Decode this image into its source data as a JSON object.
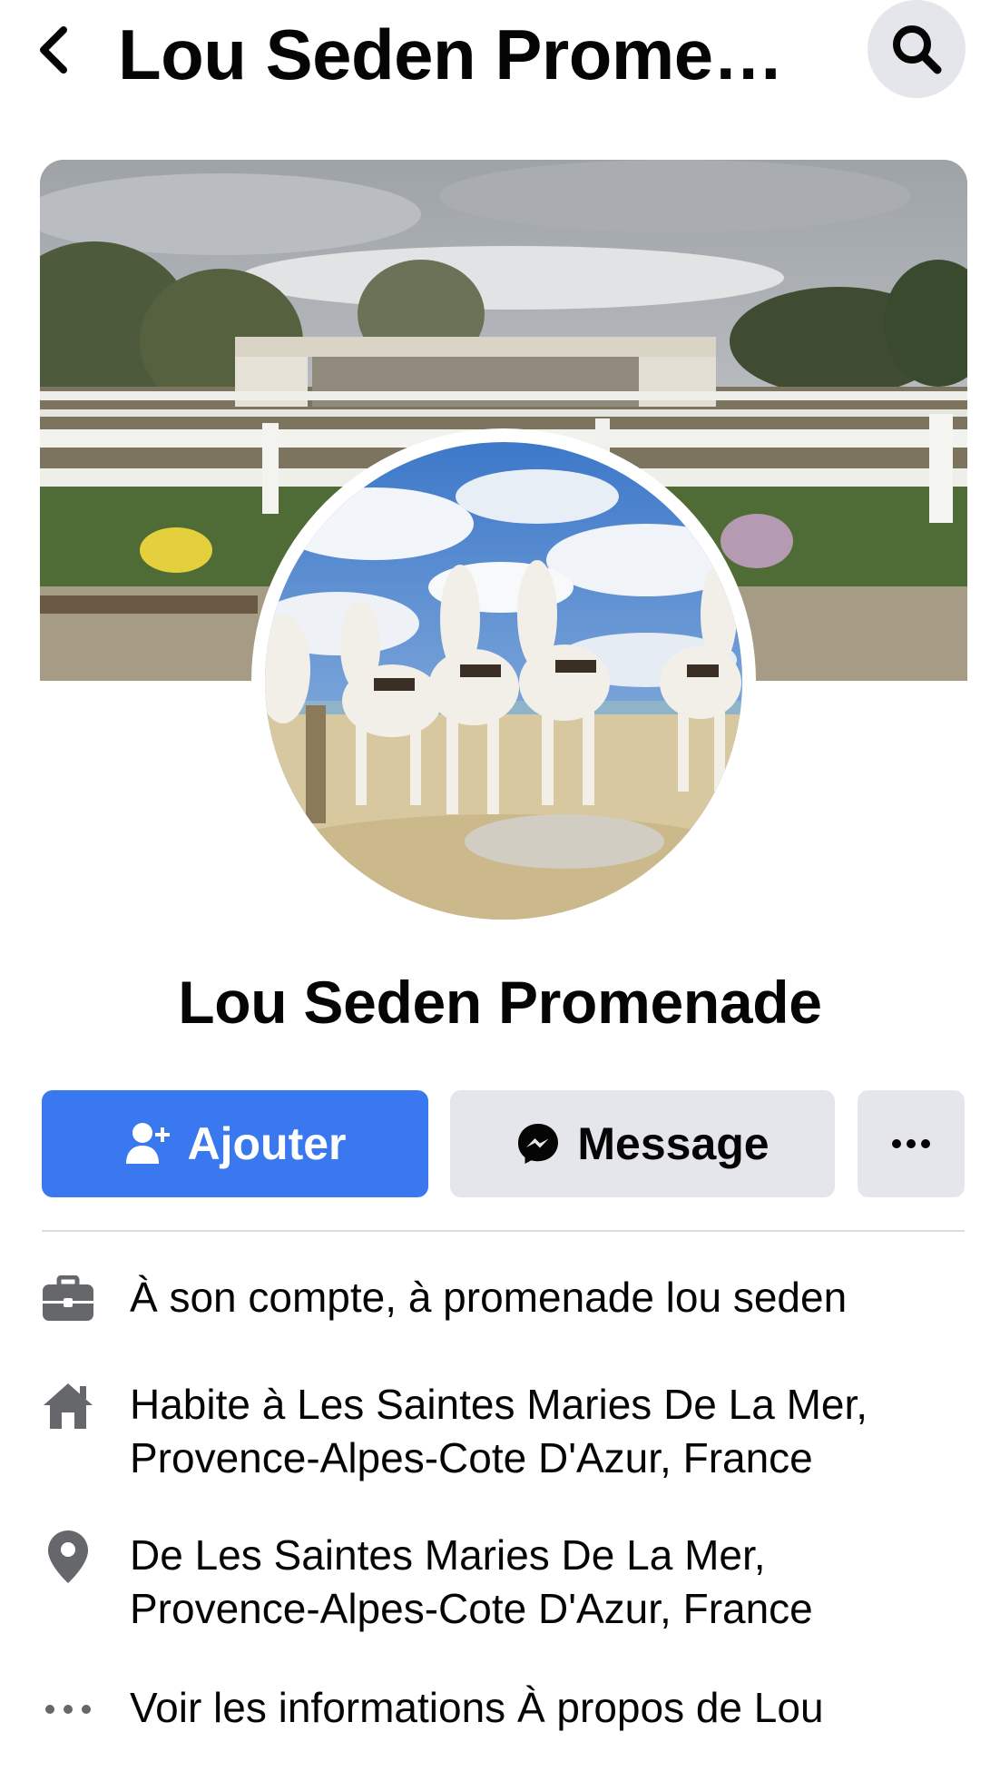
{
  "header": {
    "title": "Lou Seden Prome…"
  },
  "profile": {
    "name": "Lou Seden Promenade"
  },
  "actions": {
    "add_label": "Ajouter",
    "message_label": "Message"
  },
  "info": {
    "work": "À son compte, à promenade lou seden",
    "lives_prefix": "Habite à ",
    "lives_place": "Les Saintes Maries De La Mer, Provence-Alpes-Cote D'Azur, France",
    "from_prefix": "De ",
    "from_place": "Les Saintes Maries De La Mer, Provence-Alpes-Cote D'Azur, France",
    "about": "Voir les informations À propos de Lou"
  },
  "colors": {
    "primary": "#3a78f0",
    "secondary_button": "#e4e6eb",
    "icon_gray": "#65676b"
  }
}
